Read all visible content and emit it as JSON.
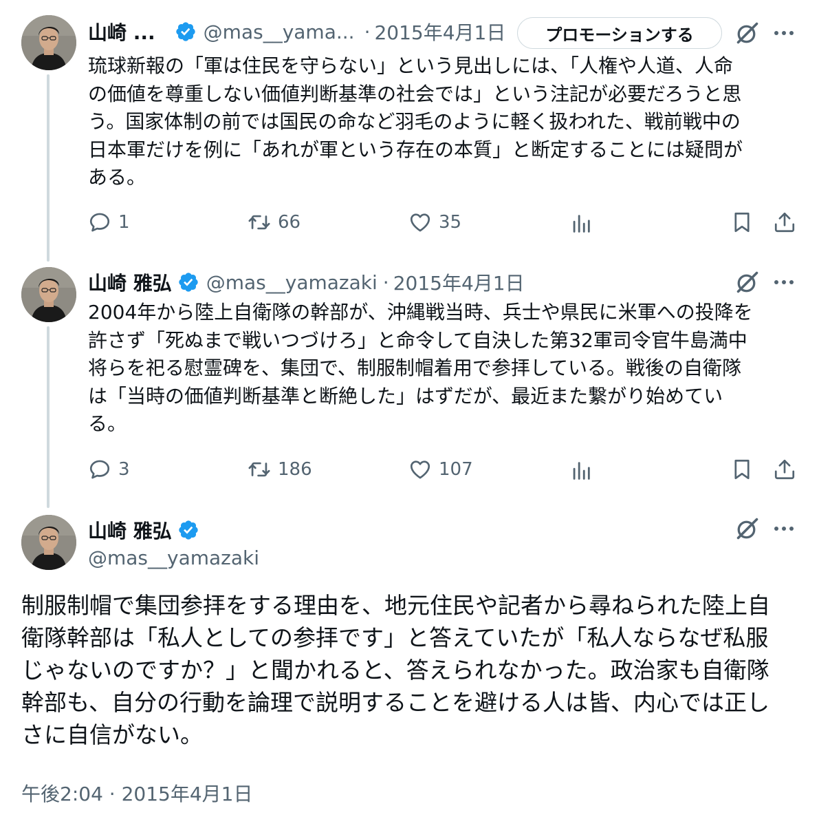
{
  "tweets": [
    {
      "name": "山崎 ...",
      "handle": "@mas__yama...",
      "separator": "·",
      "date": "2015年4月1日",
      "promote_label": "プロモーションする",
      "text": "琉球新報の「軍は住民を守らない」という見出しには、「人権や人道、人命\nの価値を尊重しない価値判断基準の社会では」という注記が必要だろうと思\nう。国家体制の前では国民の命など羽毛のように軽く扱われた、戦前戦中の\n日本軍だけを例に「あれが軍という存在の本質」と断定することには疑問が\nある。",
      "replies": "1",
      "retweets": "66",
      "likes": "35"
    },
    {
      "name": "山崎 雅弘",
      "handle": "@mas__yamazaki",
      "separator": "·",
      "date": "2015年4月1日",
      "text": "2004年から陸上自衛隊の幹部が、沖縄戦当時、兵士や県民に米軍への投降を\n許さず「死ぬまで戦いつづけろ」と命令して自決した第32軍司令官牛島満中\n将らを祀る慰霊碑を、集団で、制服制帽着用で参拝している。戦後の自衛隊\nは「当時の価値判断基準と断絶した」はずだが、最近また繋がり始めてい\nる。",
      "replies": "3",
      "retweets": "186",
      "likes": "107"
    }
  ],
  "main_tweet": {
    "name": "山崎 雅弘",
    "handle": "@mas__yamazaki",
    "text": "制服制帽で集団参拝をする理由を、地元住民や記者から尋ねられた陸上自\n衛隊幹部は「私人としての参拝です」と答えていたが「私人ならなぜ私服\nじゃないのですか？」と聞かれると、答えられなかった。政治家も自衛隊\n幹部も、自分の行動を論理で説明することを避ける人は皆、内心では正し\nさに自信がない。",
    "timestamp": "午後2:04 · 2015年4月1日"
  },
  "icons": {
    "verified": "verified-badge-icon",
    "grok": "grok-icon",
    "more": "more-icon",
    "reply": "reply-icon",
    "retweet": "retweet-icon",
    "like": "like-icon",
    "views": "views-icon",
    "bookmark": "bookmark-icon",
    "share": "share-icon"
  },
  "colors": {
    "verified": "#1d9bf0",
    "text": "#0f1419",
    "secondary": "#536471",
    "thread_line": "#cfd9de"
  }
}
